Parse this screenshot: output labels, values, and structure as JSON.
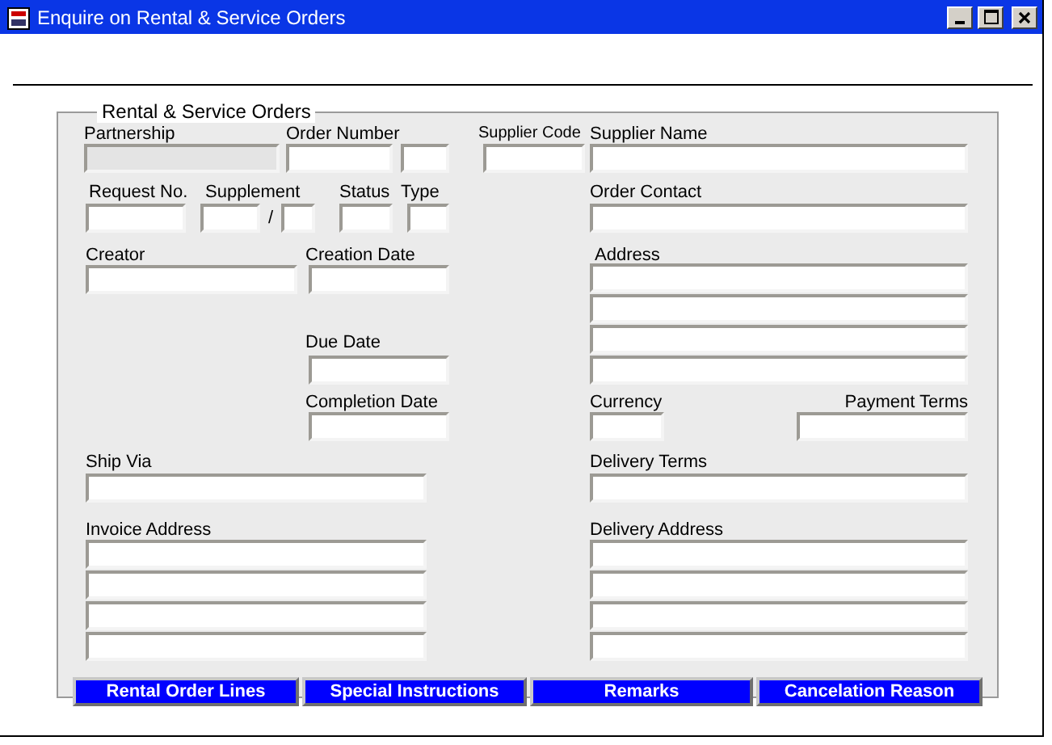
{
  "window": {
    "title": "Enquire on Rental & Service Orders"
  },
  "panel": {
    "title": "Rental & Service Orders"
  },
  "partnership": {
    "label": "Partnership",
    "disabled": true
  },
  "order_number": {
    "label": "Order Number"
  },
  "supplier_code": {
    "label": "Supplier Code"
  },
  "supplier_name": {
    "label": "Supplier Name"
  },
  "request_no": {
    "label": "Request No."
  },
  "supplement": {
    "label": "Supplement",
    "separator": "/"
  },
  "status": {
    "label": "Status"
  },
  "type": {
    "label": "Type"
  },
  "order_contact": {
    "label": "Order Contact"
  },
  "creator": {
    "label": "Creator"
  },
  "creation_date": {
    "label": "Creation Date"
  },
  "address": {
    "label": "Address"
  },
  "due_date": {
    "label": "Due Date"
  },
  "completion_date": {
    "label": "Completion Date"
  },
  "currency": {
    "label": "Currency"
  },
  "payment_terms": {
    "label": "Payment Terms"
  },
  "ship_via": {
    "label": "Ship Via"
  },
  "delivery_terms": {
    "label": "Delivery Terms"
  },
  "invoice_address": {
    "label": "Invoice Address"
  },
  "delivery_address": {
    "label": "Delivery Address"
  },
  "buttons": [
    "Rental Order Lines",
    "Special Instructions",
    "Remarks",
    "Cancelation Reason"
  ]
}
